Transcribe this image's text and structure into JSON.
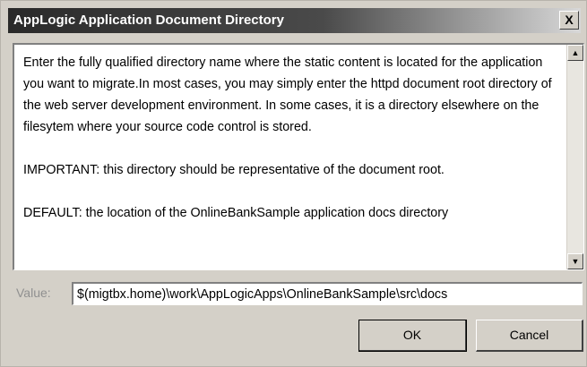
{
  "dialog": {
    "title": "AppLogic Application Document Directory",
    "close_label": "X"
  },
  "description": {
    "paragraph1": "Enter the fully qualified directory name where the static content is located for the application you want to migrate.In most cases, you may simply enter the httpd document root directory of the web server development environment.  In some cases, it is a directory elsewhere on the filesytem where your source code control is stored.",
    "paragraph2": "IMPORTANT: this directory should be representative of the document root.",
    "paragraph3": "DEFAULT: the location of the OnlineBankSample application docs directory"
  },
  "scrollbar": {
    "up_arrow": "▲",
    "down_arrow": "▼"
  },
  "value_field": {
    "label": "Value:",
    "value": "$(migtbx.home)\\work\\AppLogicApps\\OnlineBankSample\\src\\docs"
  },
  "buttons": {
    "ok_label": "OK",
    "cancel_label": "Cancel"
  },
  "colors": {
    "dialog_bg": "#d4d0c8",
    "titlebar_dark": "#2a2a2a",
    "titlebar_light": "#d8d8d8",
    "label_disabled": "#909090"
  }
}
